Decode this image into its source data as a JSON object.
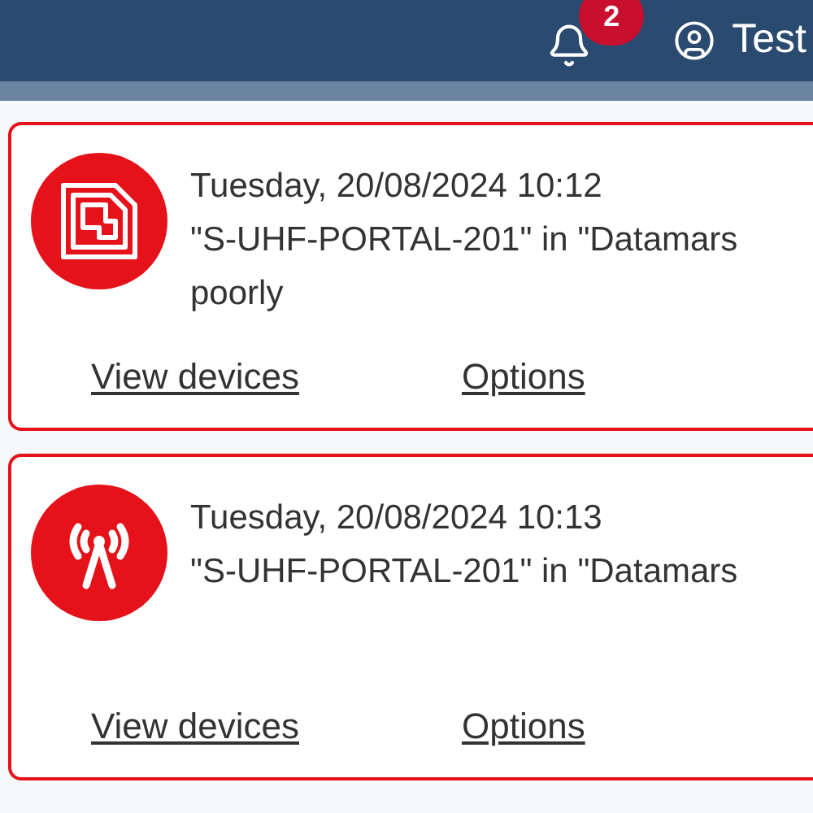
{
  "header": {
    "notification_count": "2",
    "user_name": "Test"
  },
  "notifications": [
    {
      "kind": "tag",
      "timestamp": "Tuesday, 20/08/2024 10:12",
      "message_lines": [
        "\"S-UHF-PORTAL-201\" in \"Datamars",
        "poorly"
      ],
      "actions": [
        "View devices",
        "Options"
      ]
    },
    {
      "kind": "antenna",
      "timestamp": "Tuesday, 20/08/2024 10:13",
      "message_lines": [
        "\"S-UHF-PORTAL-201\" in \"Datamars"
      ],
      "actions": [
        "View devices",
        "Options"
      ]
    }
  ]
}
